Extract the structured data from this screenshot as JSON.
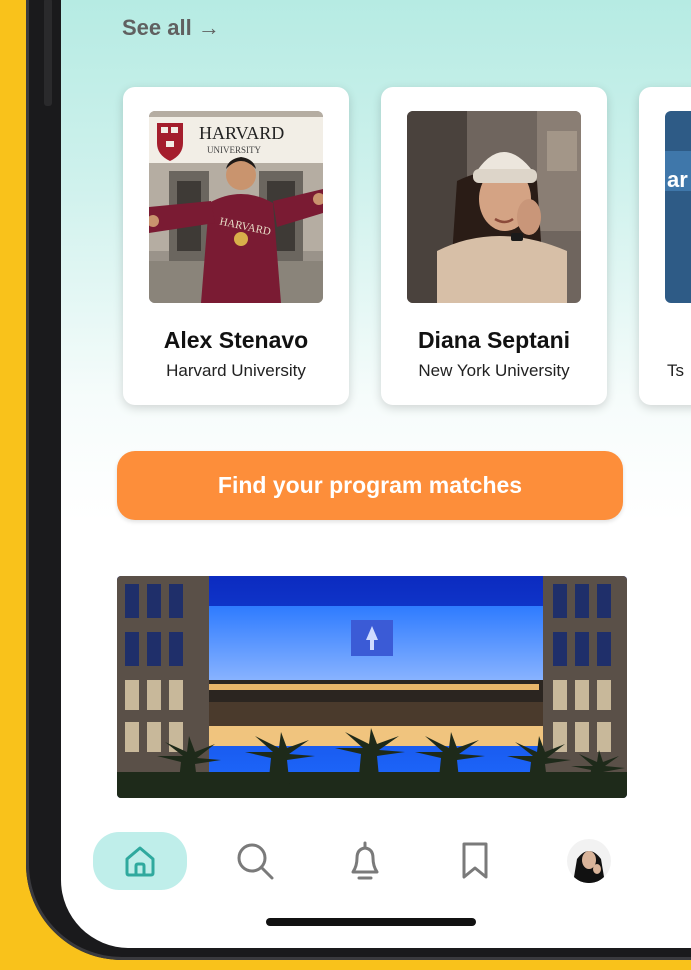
{
  "see_all": {
    "label": "See all →"
  },
  "students": [
    {
      "name": "Alex Stenavo",
      "university": "Harvard University",
      "photo_logo_text": "HARVARD",
      "photo_logo_subtext": "UNIVERSITY",
      "photo_shirt_text": "HARVARD"
    },
    {
      "name": "Diana Septani",
      "university": "New York University"
    },
    {
      "name": "",
      "university": "Ts",
      "photo_sign_text": "ar"
    }
  ],
  "cta": {
    "label": "Find your program matches"
  },
  "nav": {
    "items": [
      "home-icon",
      "search-icon",
      "bell-icon",
      "bookmark-icon",
      "profile-avatar"
    ],
    "active": "home-icon"
  },
  "colors": {
    "background": "#F9C21B",
    "accent": "#FD8E3A",
    "teal": "#49B8AE",
    "teal_light": "#BFEEEA"
  }
}
